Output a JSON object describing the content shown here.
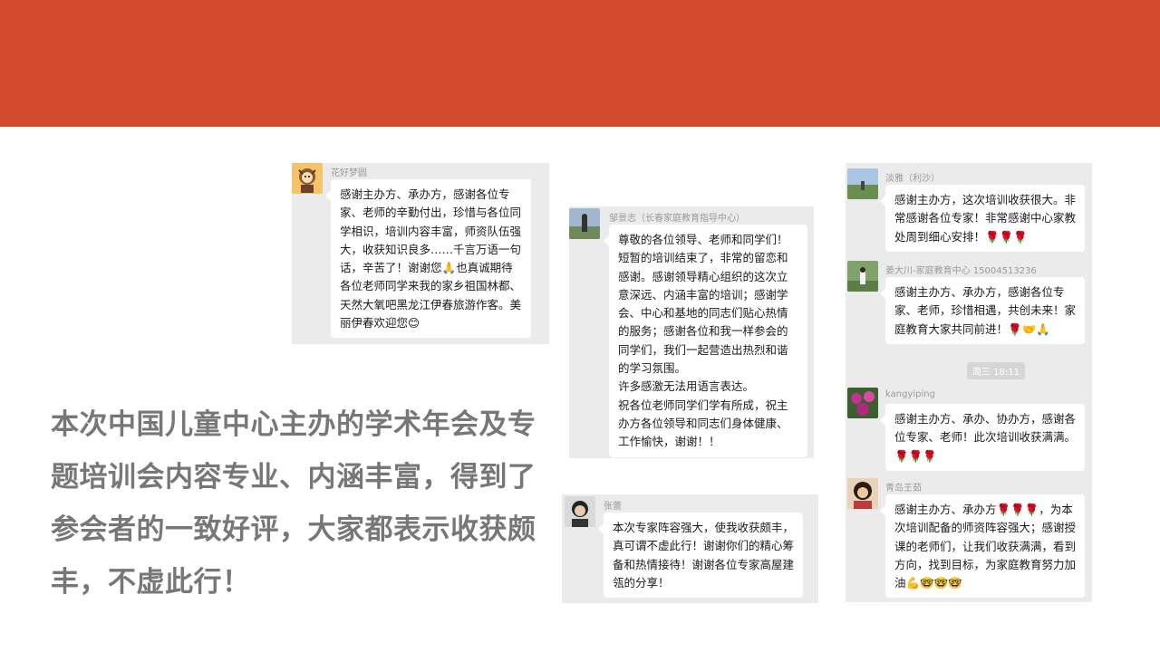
{
  "summary": "本次中国儿童中心主办的学术年会及专题培训会内容专业、内涵丰富，得到了参会者的一致好评，大家都表示收获颇丰，不虚此行！",
  "colors": {
    "banner": "#d24a2b",
    "panel": "#ebebeb",
    "summary_text": "#777777"
  },
  "panel1": {
    "messages": [
      {
        "name": "花好梦圆",
        "avatar_icon": "cartoon-avatar-icon",
        "text": "感谢主办方、承办方，感谢各位专家、老师的辛勤付出，珍惜与各位同学相识，培训内容丰富，师资队伍强大，收获知识良多……千言万语一句话，辛苦了！谢谢您🙏也真诚期待各位老师同学来我的家乡祖国林都、天然大氧吧黑龙江伊春旅游作客。美丽伊春欢迎您😊"
      }
    ]
  },
  "panel2": {
    "messages": [
      {
        "name": "邹景志（长春家庭教育指导中心）",
        "avatar_icon": "photo-avatar-icon",
        "text": "尊敬的各位领导、老师和同学们！短暂的培训结束了，非常的留恋和感谢。感谢领导精心组织的这次立意深远、内涵丰富的培训；感谢学会、中心和基地的同志们贴心热情的服务；感谢各位和我一样参会的同学们，我们一起营造出热烈和谐的学习氛围。\n许多感激无法用语言表达。\n祝各位老师同学们学有所成，祝主办方各位领导和同志们身体健康、工作愉快，谢谢！！"
      }
    ]
  },
  "panel3": {
    "messages": [
      {
        "name": "张蕾",
        "avatar_icon": "portrait-avatar-icon",
        "text": "本次专家阵容强大，使我收获颇丰，真可谓不虚此行！谢谢你们的精心筹备和热情接待！谢谢各位专家高屋建瓴的分享！"
      }
    ]
  },
  "panel4": {
    "time_tag": "周三 18:11",
    "messages": [
      {
        "name": "淡雅（利沙）",
        "avatar_icon": "landscape-avatar-icon",
        "text": "感谢主办方，这次培训收获很大。非常感谢各位专家！非常感谢中心家教处周到细心安排！🌹🌹🌹"
      },
      {
        "name": "姜大川-家庭教育中心 15004513236",
        "avatar_icon": "person-avatar-icon",
        "text": "感谢主办方、承办方，感谢各位专家、老师，珍惜相遇，共创未来！家庭教育大家共同前进！🌹🤝🙏"
      },
      {
        "name": "kangyiping",
        "avatar_icon": "flower-avatar-icon",
        "text": "感谢主办方、承办、协办方，感谢各位专家、老师！此次培训收获满满。🌹🌹🌹"
      },
      {
        "name": "青岛王茹",
        "avatar_icon": "woman-avatar-icon",
        "text": "感谢主办方、承办方🌹🌹🌹，为本次培训配备的师资阵容强大；感谢授课的老师们，让我们收获满满，看到方向，找到目标，为家庭教育努力加油💪🤓🤓🤓"
      }
    ]
  }
}
